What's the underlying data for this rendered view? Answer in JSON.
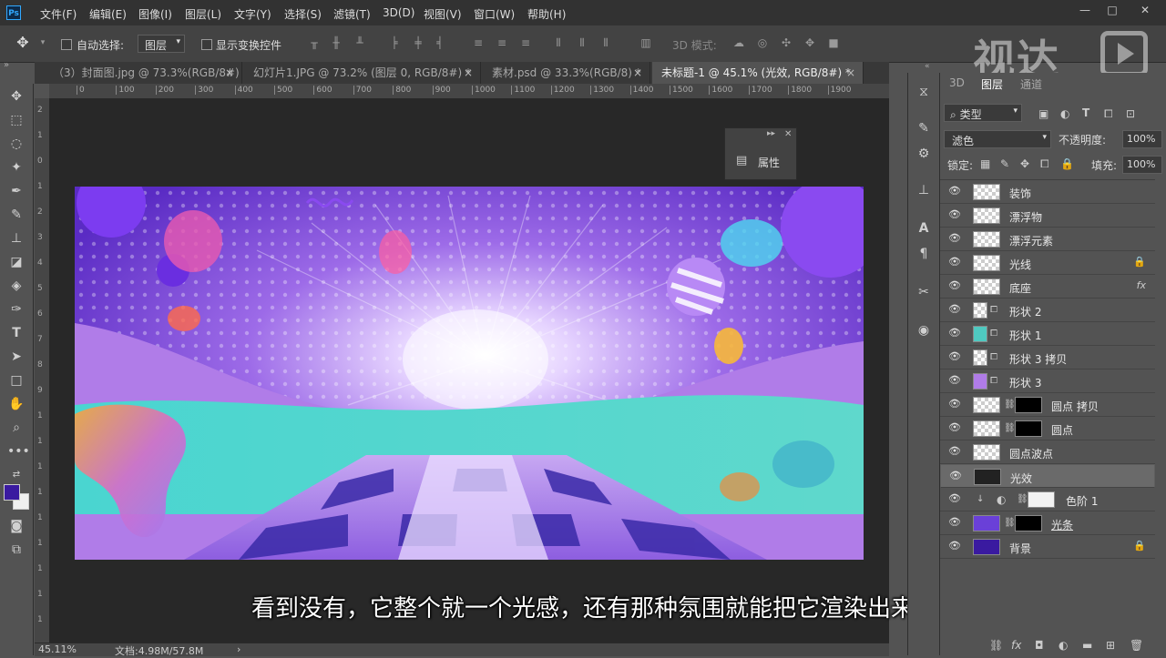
{
  "menubar": {
    "logo": "Ps",
    "items": [
      "文件(F)",
      "编辑(E)",
      "图像(I)",
      "图层(L)",
      "文字(Y)",
      "选择(S)",
      "滤镜(T)",
      "3D(D)",
      "视图(V)",
      "窗口(W)",
      "帮助(H)"
    ],
    "window_controls": [
      "—",
      "□",
      "✕"
    ]
  },
  "options": {
    "auto_select_label": "自动选择:",
    "auto_select_value": "图层",
    "show_transform_label": "显示变换控件",
    "mode_3d_label": "3D 模式:"
  },
  "watermark": {
    "text": "视达"
  },
  "tabs": [
    {
      "label": "（3）封面图.jpg @ 73.3%(RGB/8#)",
      "close": "×"
    },
    {
      "label": "幻灯片1.JPG @ 73.2% (图层 0, RGB/8#) *",
      "close": "×"
    },
    {
      "label": "素材.psd @ 33.3%(RGB/8) *",
      "close": "×"
    },
    {
      "label": "未标题-1 @ 45.1% (光效, RGB/8#) *",
      "close": "×"
    }
  ],
  "ruler": {
    "h_labels": [
      "0",
      "100",
      "200",
      "300",
      "400",
      "500",
      "600",
      "700",
      "800",
      "900",
      "1000",
      "1100",
      "1200",
      "1300",
      "1400",
      "1500",
      "1600",
      "1700",
      "1800",
      "1900"
    ],
    "v_labels": [
      "2",
      "1",
      "0",
      "1",
      "2",
      "3",
      "4",
      "5",
      "6",
      "7",
      "8",
      "9",
      "1",
      "1",
      "1",
      "1",
      "1",
      "1",
      "1",
      "1",
      "1"
    ]
  },
  "properties_panel": {
    "label": "属性"
  },
  "statusbar": {
    "zoom": "45.11%",
    "doc": "文档:4.98M/57.8M"
  },
  "subtitle": "看到没有，它整个就一个光感，还有那种氛围就能把它渲染出来",
  "layers_panel": {
    "tabs": [
      "3D",
      "图层",
      "通道"
    ],
    "filter_label": "类型",
    "blend_mode": "滤色",
    "opacity_label": "不透明度:",
    "opacity_value": "100%",
    "lock_label": "锁定:",
    "fill_label": "填充:",
    "fill_value": "100%",
    "layers": [
      {
        "name": "装饰",
        "right": ""
      },
      {
        "name": "漂浮物",
        "right": ""
      },
      {
        "name": "漂浮元素",
        "right": ""
      },
      {
        "name": "光线",
        "right": "🔒"
      },
      {
        "name": "底座",
        "right": "fx"
      },
      {
        "name": "形状 2",
        "right": ""
      },
      {
        "name": "形状 1",
        "right": ""
      },
      {
        "name": "形状 3 拷贝",
        "right": ""
      },
      {
        "name": "形状 3",
        "right": ""
      },
      {
        "name": "圆点 拷贝",
        "right": ""
      },
      {
        "name": "圆点",
        "right": ""
      },
      {
        "name": "圆点波点",
        "right": ""
      },
      {
        "name": "光效",
        "right": ""
      },
      {
        "name": "色阶 1",
        "right": ""
      },
      {
        "name": "光条",
        "right": ""
      },
      {
        "name": "背景",
        "right": "🔒"
      }
    ]
  },
  "colors": {
    "foreground": "#3a1aa0",
    "background": "#f0f0f0"
  }
}
